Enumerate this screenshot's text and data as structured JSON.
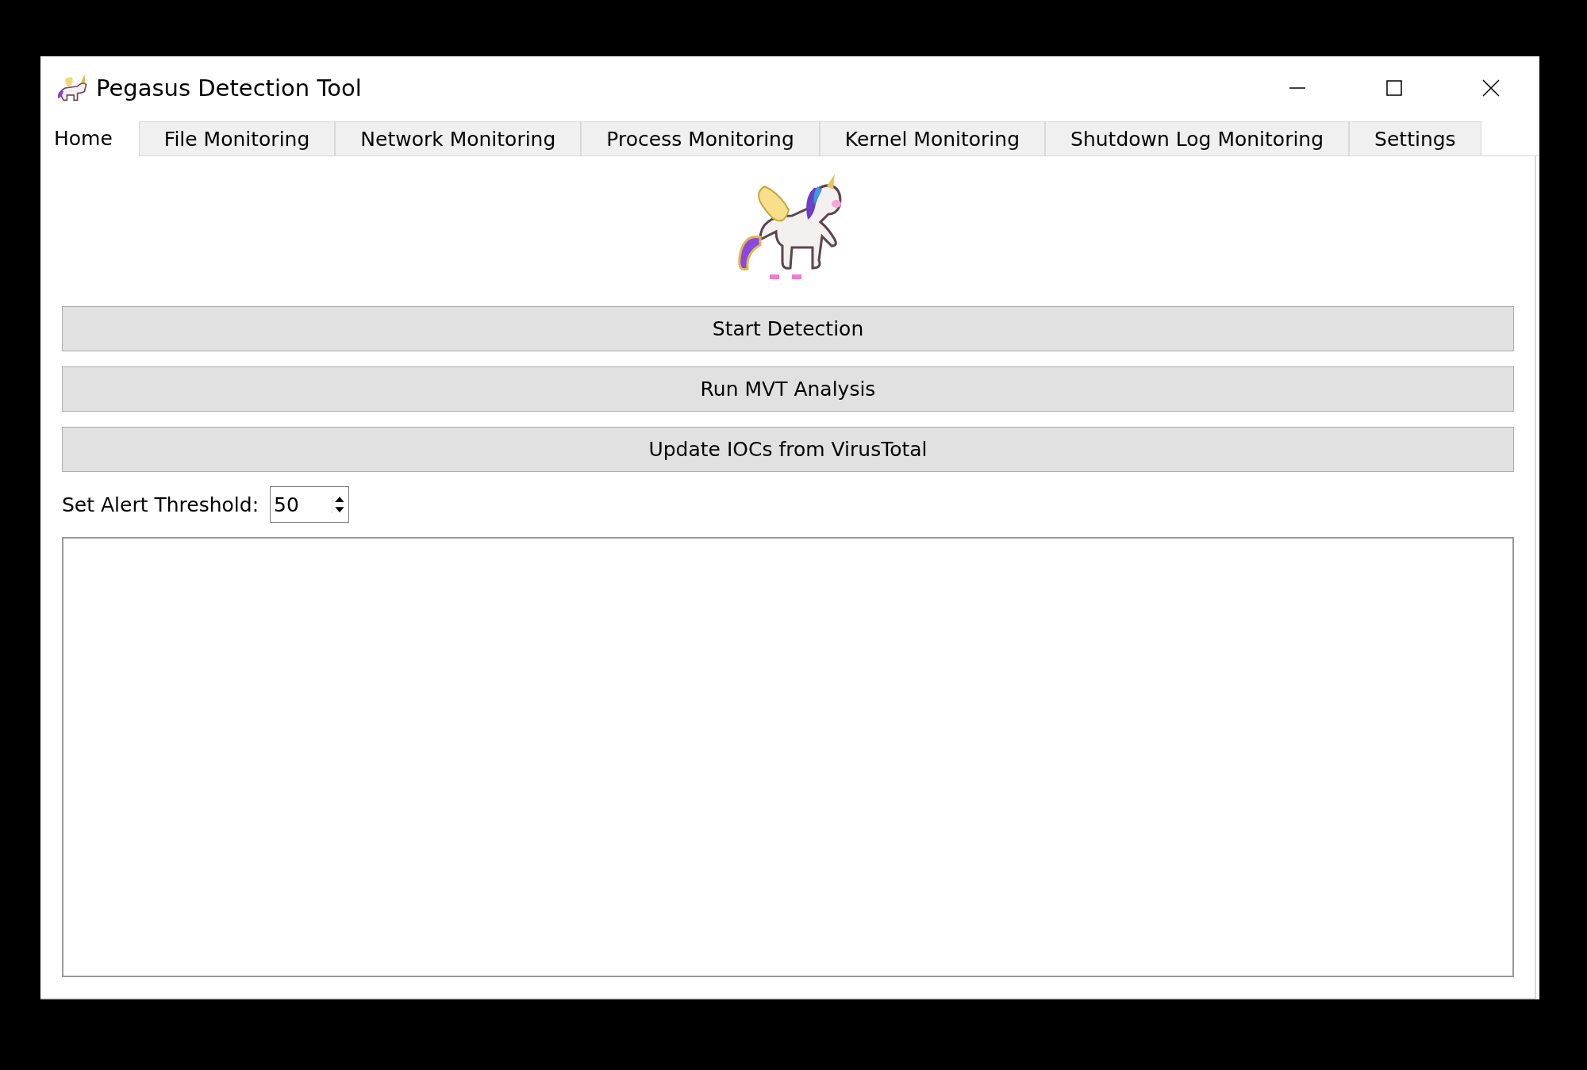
{
  "window": {
    "title": "Pegasus Detection Tool"
  },
  "tabs": [
    {
      "label": "Home",
      "selected": true
    },
    {
      "label": "File Monitoring",
      "selected": false
    },
    {
      "label": "Network Monitoring",
      "selected": false
    },
    {
      "label": "Process Monitoring",
      "selected": false
    },
    {
      "label": "Kernel Monitoring",
      "selected": false
    },
    {
      "label": "Shutdown Log Monitoring",
      "selected": false
    },
    {
      "label": "Settings",
      "selected": false
    }
  ],
  "buttons": [
    "Start Detection",
    "Run MVT Analysis",
    "Update IOCs from VirusTotal"
  ],
  "threshold": {
    "label": "Set Alert Threshold:",
    "value": "50"
  }
}
